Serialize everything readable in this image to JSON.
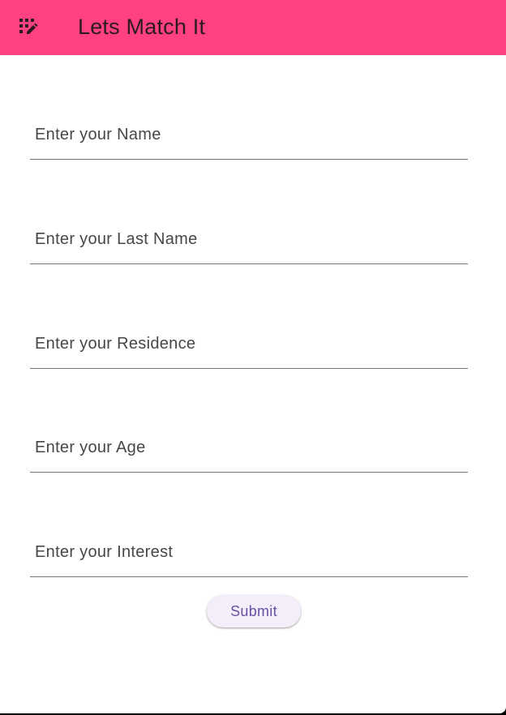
{
  "appbar": {
    "title": "Lets Match It",
    "icon": "dashboard-customize-icon",
    "background": "#ff4081"
  },
  "form": {
    "fields": [
      {
        "name": "name",
        "placeholder": "Enter your Name",
        "value": ""
      },
      {
        "name": "last-name",
        "placeholder": "Enter your Last Name",
        "value": ""
      },
      {
        "name": "residence",
        "placeholder": "Enter your Residence",
        "value": ""
      },
      {
        "name": "age",
        "placeholder": "Enter your Age",
        "value": ""
      },
      {
        "name": "interest",
        "placeholder": "Enter your Interest",
        "value": ""
      }
    ],
    "submit_label": "Submit",
    "submit_color": "#6b4fa3"
  }
}
